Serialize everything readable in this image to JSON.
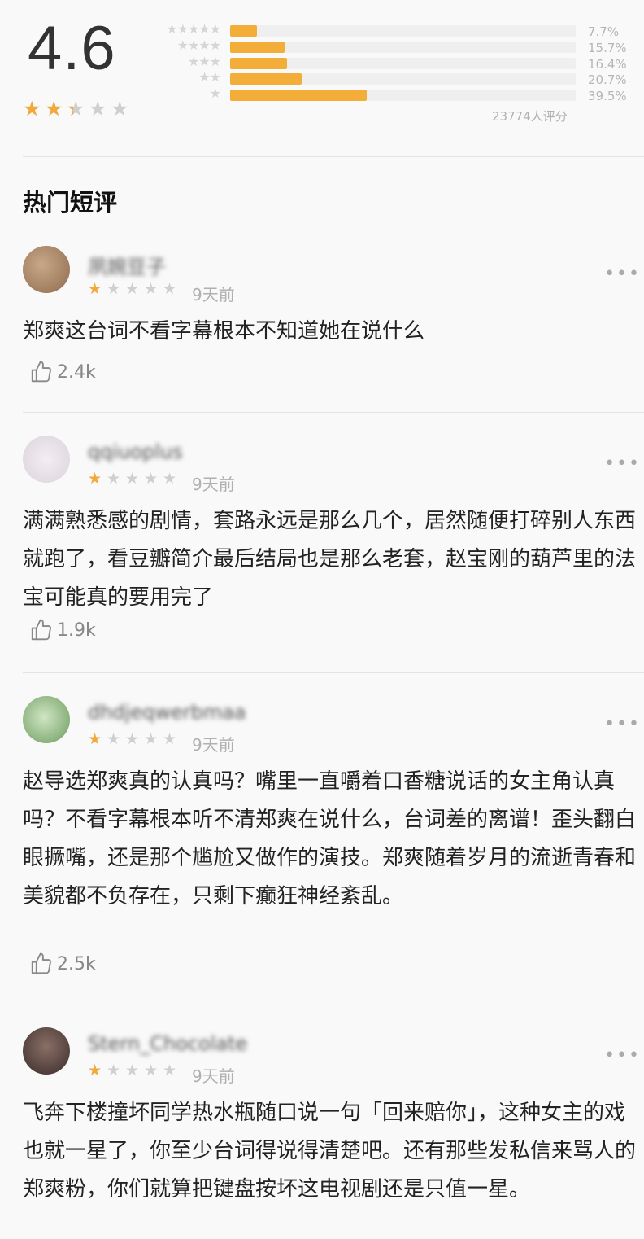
{
  "rating": {
    "score": "4.6",
    "stars_value": 2.3,
    "distribution": [
      {
        "stars": 5,
        "percent_label": "7.7%",
        "percent": 7.7
      },
      {
        "stars": 4,
        "percent_label": "15.7%",
        "percent": 15.7
      },
      {
        "stars": 3,
        "percent_label": "16.4%",
        "percent": 16.4
      },
      {
        "stars": 2,
        "percent_label": "20.7%",
        "percent": 20.7
      },
      {
        "stars": 1,
        "percent_label": "39.5%",
        "percent": 39.5
      }
    ],
    "total_label": "23774人评分"
  },
  "section_title": "热门短评",
  "colors": {
    "star": "#f3a838",
    "bar": "#f3ae3a"
  },
  "reviews": [
    {
      "username": "夙婉豆子",
      "stars": 1,
      "time": "9天前",
      "text": "郑爽这台词不看字幕根本不知道她在说什么",
      "likes": "2.4k",
      "more_icon": "more-dots-icon"
    },
    {
      "username": "qqiuoplus",
      "stars": 1,
      "time": "9天前",
      "text": "满满熟悉感的剧情，套路永远是那么几个，居然随便打碎别人东西就跑了，看豆瓣简介最后结局也是那么老套，赵宝刚的葫芦里的法宝可能真的要用完了",
      "likes": "1.9k",
      "more_icon": "more-dots-icon"
    },
    {
      "username": "dhdjeqwerbmaa",
      "stars": 1,
      "time": "9天前",
      "text": "赵导选郑爽真的认真吗？嘴里一直嚼着口香糖说话的女主角认真吗？不看字幕根本听不清郑爽在说什么，台词差的离谱！歪头翻白眼撅嘴，还是那个尴尬又做作的演技。郑爽随着岁月的流逝青春和美貌都不负存在，只剩下癫狂神经紊乱。",
      "likes": "2.5k",
      "more_icon": "more-dots-icon"
    },
    {
      "username": "Stern_Chocolate",
      "stars": 1,
      "time": "9天前",
      "text": "飞奔下楼撞坏同学热水瓶随口说一句「回来赔你」，这种女主的戏也就一星了，你至少台词得说得清楚吧。还有那些发私信来骂人的郑爽粉，你们就算把键盘按坏这电视剧还是只值一星。",
      "likes": "",
      "more_icon": "more-dots-icon"
    }
  ]
}
